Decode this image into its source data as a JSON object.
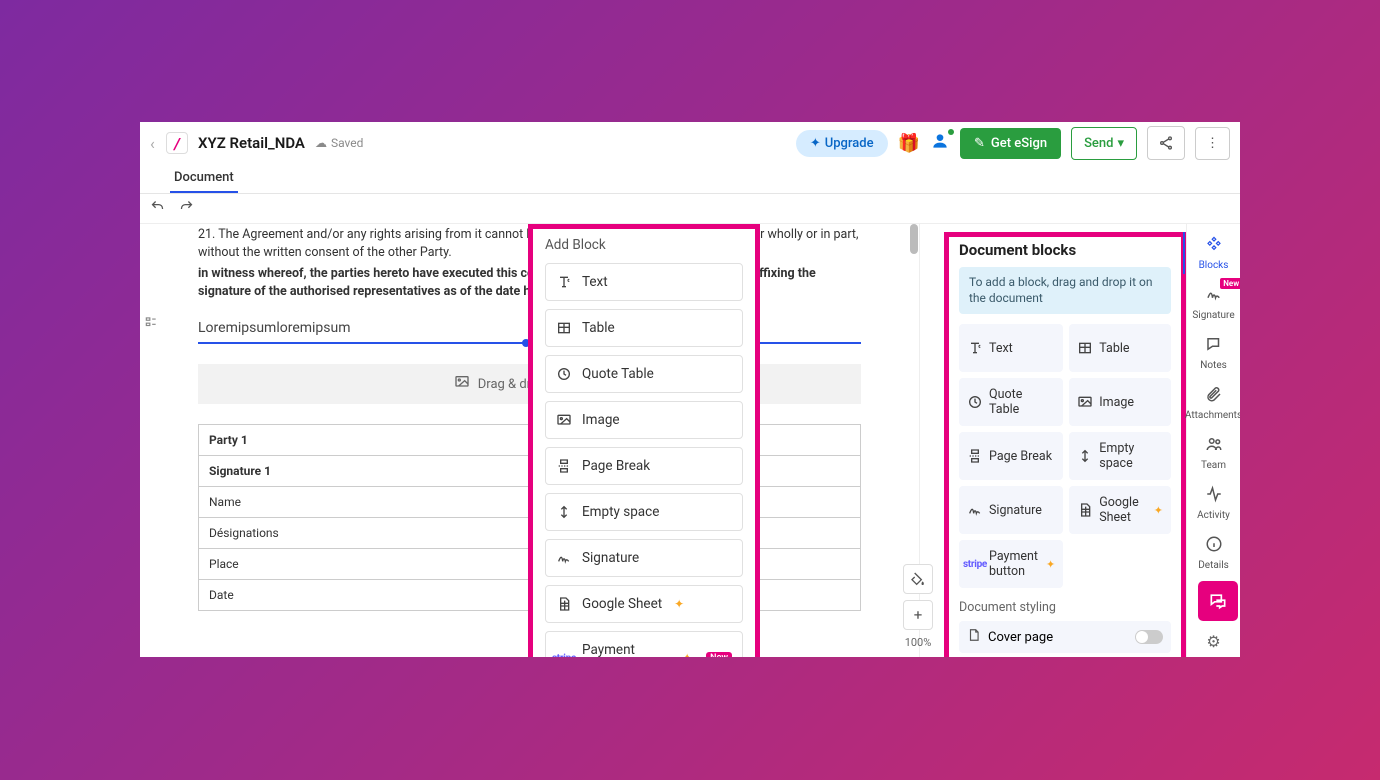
{
  "colors": {
    "accent": "#e6007e",
    "primary_blue": "#2651e8",
    "green": "#2a9d3f"
  },
  "topbar": {
    "doc_title": "XYZ Retail_NDA",
    "saved_label": "Saved",
    "upgrade_label": "Upgrade",
    "esign_label": "Get eSign",
    "send_label": "Send"
  },
  "tabs": {
    "document": "Document"
  },
  "document": {
    "para1": "21. The Agreement and/or any rights arising from it cannot be assigned or otherwise transferred either wholly or in part, without the written consent of the other Party.",
    "para2": "in witness whereof, the parties hereto have executed this confidentiality agreement in duplicate by affixing the signature of the authorised representatives as of the date herein above mentioned.",
    "lorem": "Loremipsumloremipsum",
    "img_drop": "Drag & drop image file",
    "table": {
      "rows": [
        {
          "label": "Party 1",
          "bold": true
        },
        {
          "label": "Signature 1",
          "bold": true
        },
        {
          "label": "Name",
          "bold": false
        },
        {
          "label": "Désignations",
          "bold": false
        },
        {
          "label": "Place",
          "bold": false
        },
        {
          "label": "Date",
          "bold": false
        }
      ]
    }
  },
  "zoom": {
    "pct": "100%"
  },
  "add_block_popup": {
    "title": "Add Block",
    "items": [
      {
        "icon": "text",
        "label": "Text"
      },
      {
        "icon": "table",
        "label": "Table"
      },
      {
        "icon": "quote",
        "label": "Quote Table"
      },
      {
        "icon": "image",
        "label": "Image"
      },
      {
        "icon": "pagebreak",
        "label": "Page Break"
      },
      {
        "icon": "empty",
        "label": "Empty space"
      },
      {
        "icon": "signature",
        "label": "Signature"
      },
      {
        "icon": "sheet",
        "label": "Google Sheet",
        "sparkle": true
      },
      {
        "icon": "stripe",
        "label": "Payment button",
        "sparkle": true,
        "new": true
      }
    ]
  },
  "blocks_panel": {
    "title": "Document blocks",
    "hint": "To add a block, drag and drop it on the document",
    "tiles": [
      {
        "icon": "text",
        "label": "Text"
      },
      {
        "icon": "table",
        "label": "Table"
      },
      {
        "icon": "quote",
        "label": "Quote Table"
      },
      {
        "icon": "image",
        "label": "Image"
      },
      {
        "icon": "pagebreak",
        "label": "Page Break"
      },
      {
        "icon": "empty",
        "label": "Empty space"
      },
      {
        "icon": "signature",
        "label": "Signature"
      },
      {
        "icon": "sheet",
        "label": "Google Sheet",
        "sparkle": true
      },
      {
        "icon": "stripe",
        "label": "Payment button",
        "sparkle": true
      }
    ],
    "styling_title": "Document styling",
    "cover_label": "Cover page"
  },
  "rail": {
    "items": [
      {
        "key": "blocks",
        "label": "Blocks",
        "active": true
      },
      {
        "key": "signature",
        "label": "Signature",
        "new": true
      },
      {
        "key": "notes",
        "label": "Notes"
      },
      {
        "key": "attachments",
        "label": "Attachments"
      },
      {
        "key": "team",
        "label": "Team"
      },
      {
        "key": "activity",
        "label": "Activity"
      },
      {
        "key": "details",
        "label": "Details"
      }
    ]
  }
}
